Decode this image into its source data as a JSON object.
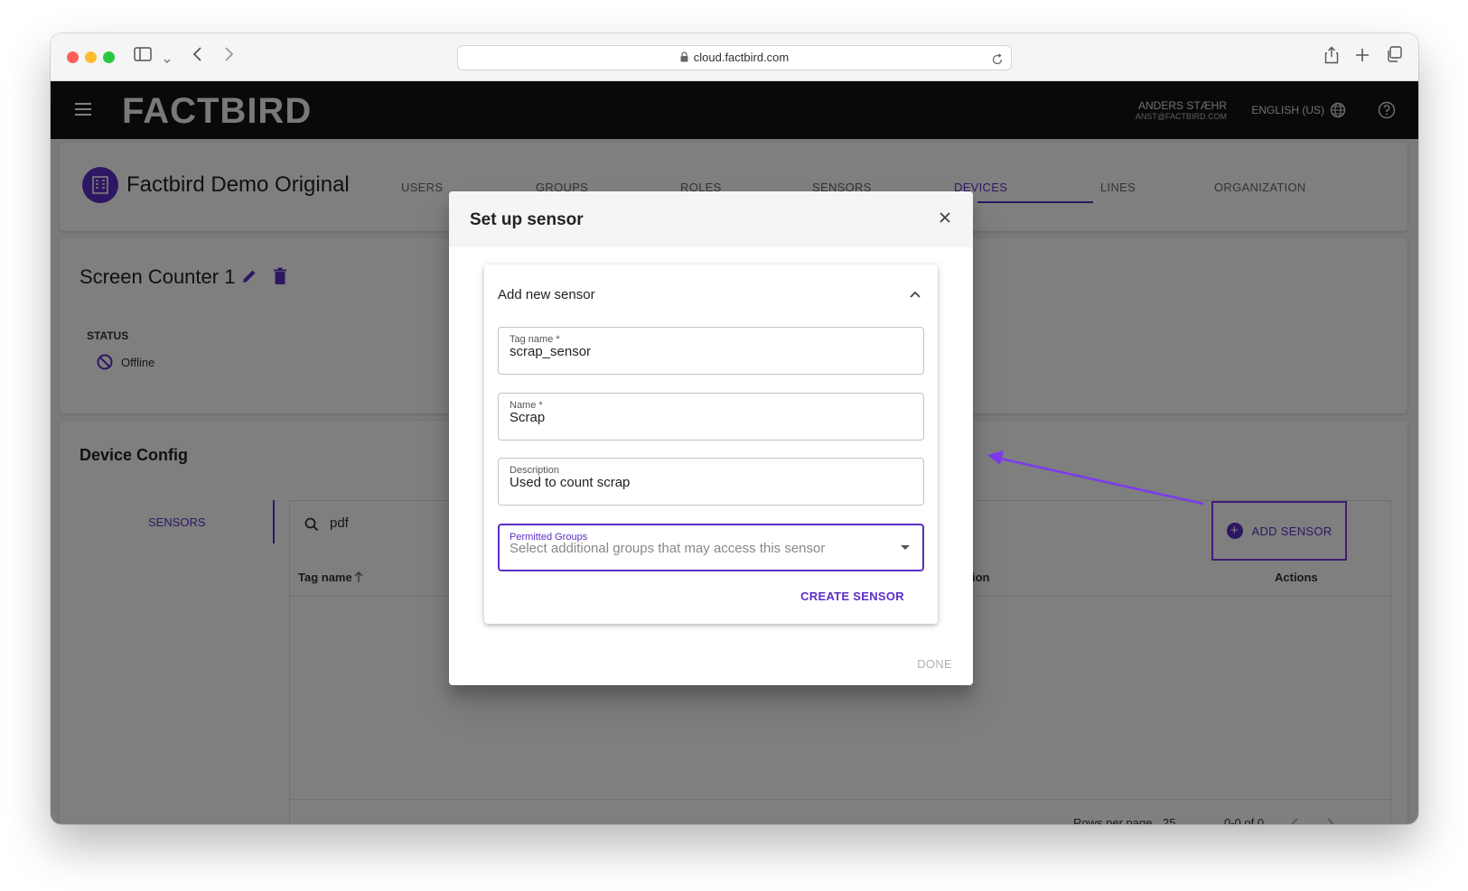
{
  "browser": {
    "url": "cloud.factbird.com"
  },
  "appbar": {
    "logo": "FACTBIRD",
    "user_name": "ANDERS STÆHR",
    "user_email": "ANST@FACTBIRD.COM",
    "language": "ENGLISH (US)"
  },
  "org": {
    "title": "Factbird Demo Original",
    "tabs": [
      {
        "label": "USERS"
      },
      {
        "label": "GROUPS"
      },
      {
        "label": "ROLES"
      },
      {
        "label": "SENSORS"
      },
      {
        "label": "DEVICES"
      },
      {
        "label": "LINES"
      },
      {
        "label": "ORGANIZATION"
      }
    ],
    "active_tab": "DEVICES"
  },
  "device": {
    "title": "Screen Counter 1",
    "status_label": "STATUS",
    "status_value": "Offline"
  },
  "config": {
    "title": "Device Config",
    "side_tab": "SENSORS",
    "search_value": "pdf",
    "add_sensor_label": "ADD SENSOR",
    "columns": [
      "Tag name",
      "ion",
      "Actions"
    ],
    "rows_per_page_label": "Rows per page",
    "rows_per_page_value": "25",
    "pagination": "0-0 of 0"
  },
  "dialog": {
    "title": "Set up sensor",
    "panel_title": "Add new sensor",
    "fields": [
      {
        "label": "Tag name *",
        "value": "scrap_sensor"
      },
      {
        "label": "Name *",
        "value": "Scrap"
      },
      {
        "label": "Description",
        "value": "Used to count scrap"
      },
      {
        "label": "Permitted Groups",
        "placeholder": "Select additional groups that may access this sensor"
      }
    ],
    "create_label": "CREATE SENSOR",
    "done_label": "DONE"
  },
  "colors": {
    "accent": "#5b2fc7",
    "annotation": "#7c3aed",
    "appbar": "#121212"
  }
}
